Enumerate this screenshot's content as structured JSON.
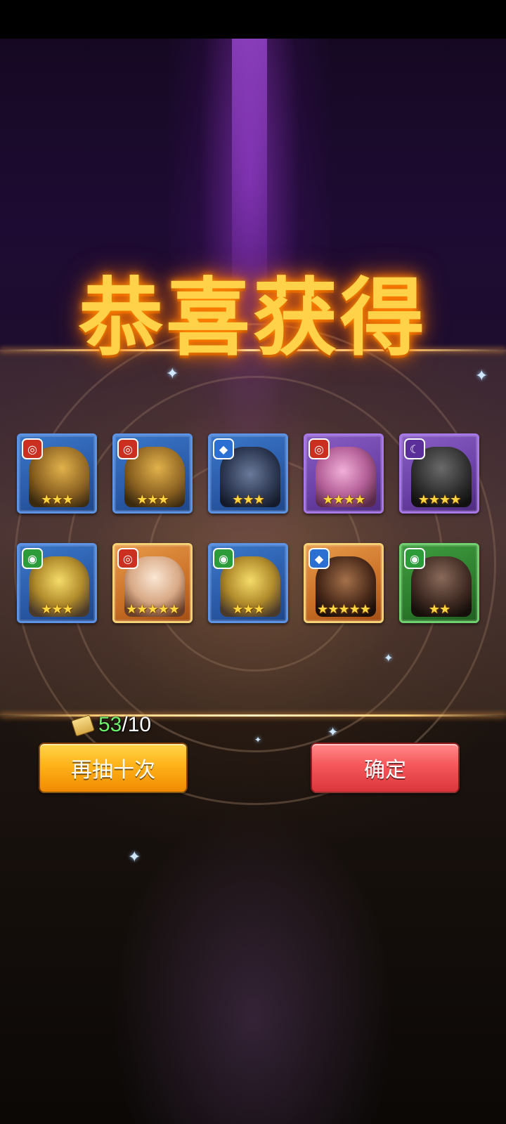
{
  "title": "恭喜获得",
  "results": [
    {
      "element": "fire",
      "element_icon": "fire-element-icon",
      "stars": 3,
      "rarity": "blue",
      "art": "cat"
    },
    {
      "element": "fire",
      "element_icon": "fire-element-icon",
      "stars": 3,
      "rarity": "blue",
      "art": "cat"
    },
    {
      "element": "water",
      "element_icon": "water-element-icon",
      "stars": 3,
      "rarity": "blue",
      "art": "crab"
    },
    {
      "element": "fire",
      "element_icon": "fire-element-icon",
      "stars": 4,
      "rarity": "purple",
      "art": "bug"
    },
    {
      "element": "dark",
      "element_icon": "dark-element-icon",
      "stars": 4,
      "rarity": "purple",
      "art": "hood"
    },
    {
      "element": "wind",
      "element_icon": "wind-element-icon",
      "stars": 3,
      "rarity": "blue",
      "art": "frog"
    },
    {
      "element": "fire",
      "element_icon": "fire-element-icon",
      "stars": 5,
      "rarity": "gold",
      "art": "girl"
    },
    {
      "element": "wind",
      "element_icon": "wind-element-icon",
      "stars": 3,
      "rarity": "blue",
      "art": "frog"
    },
    {
      "element": "water",
      "element_icon": "water-element-icon",
      "stars": 5,
      "rarity": "gold",
      "art": "dragon"
    },
    {
      "element": "wind",
      "element_icon": "wind-element-icon",
      "stars": 2,
      "rarity": "green",
      "art": "monk"
    }
  ],
  "scroll": {
    "icon": "scroll-icon",
    "have": "53",
    "separator": "/",
    "need": "10"
  },
  "buttons": {
    "again_label": "再抽十次",
    "confirm_label": "确定"
  },
  "colors": {
    "title": "#ffd24a",
    "again": "#ffb21a",
    "confirm": "#f5575a",
    "have": "#6ef06a"
  }
}
